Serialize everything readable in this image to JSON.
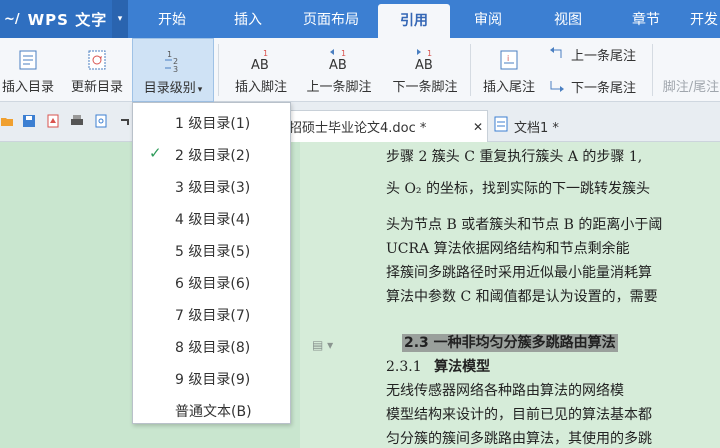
{
  "app": {
    "logo": "~/",
    "title": "WPS 文字",
    "menu_arrow": "▾"
  },
  "tabs": [
    "开始",
    "插入",
    "页面布局",
    "引用",
    "审阅",
    "视图",
    "章节",
    "开发"
  ],
  "ribbon": {
    "insert_toc": "插入目录",
    "update_toc": "更新目录",
    "toc_level": "目录级别",
    "toc_level_arrow": "▾",
    "insert_footnote": "插入脚注",
    "prev_footnote": "上一条脚注",
    "next_footnote": "下一条脚注",
    "insert_endnote": "插入尾注",
    "prev_endnote": "上一条尾注",
    "next_endnote": "下一条尾注",
    "footnote_endnote": "脚注/尾注"
  },
  "toc_menu": {
    "items": [
      "1 级目录(1)",
      "2 级目录(2)",
      "3 级目录(3)",
      "4 级目录(4)",
      "5 级目录(5)",
      "6 级目录(6)",
      "7 级目录(7)",
      "8 级目录(8)",
      "9 级目录(9)",
      "普通文本(B)"
    ],
    "checked_item": "2 级目录(2)",
    "check_mark": "✓"
  },
  "doc_tabs": {
    "active": "招硕士毕业论文4.doc *",
    "close": "✕",
    "other": "文档1 *"
  },
  "document": {
    "lines": [
      "步骤 2   簇头 C 重复执行簇头 A 的步骤 1,",
      "头 O₂ 的坐标，找到实际的下一跳转发簇头",
      "头为节点 B 或者簇头和节点 B 的距离小于阈",
      "    UCRA 算法依据网络结构和节点剩余能",
      "择簇间多跳路径时采用近似最小能量消耗算",
      "算法中参数 C 和阈值都是认为设置的，需要"
    ],
    "section_heading": "2.3 一种非均匀分簇多跳路由算法",
    "sub_number": "2.3.1",
    "sub_title": "算法模型",
    "body_lines": [
      "    无线传感器网络各种路由算法的网络模",
      "模型结构来设计的，目前已见的算法基本都",
      "匀分簇的簇间多跳路由算法，其使用的多跳"
    ]
  },
  "colors": {
    "title_bar": "#3c7fd2",
    "ribbon_bg": "#f5f7fa",
    "doc_bg": "#c9e6cf",
    "check": "#2e9b5a"
  }
}
